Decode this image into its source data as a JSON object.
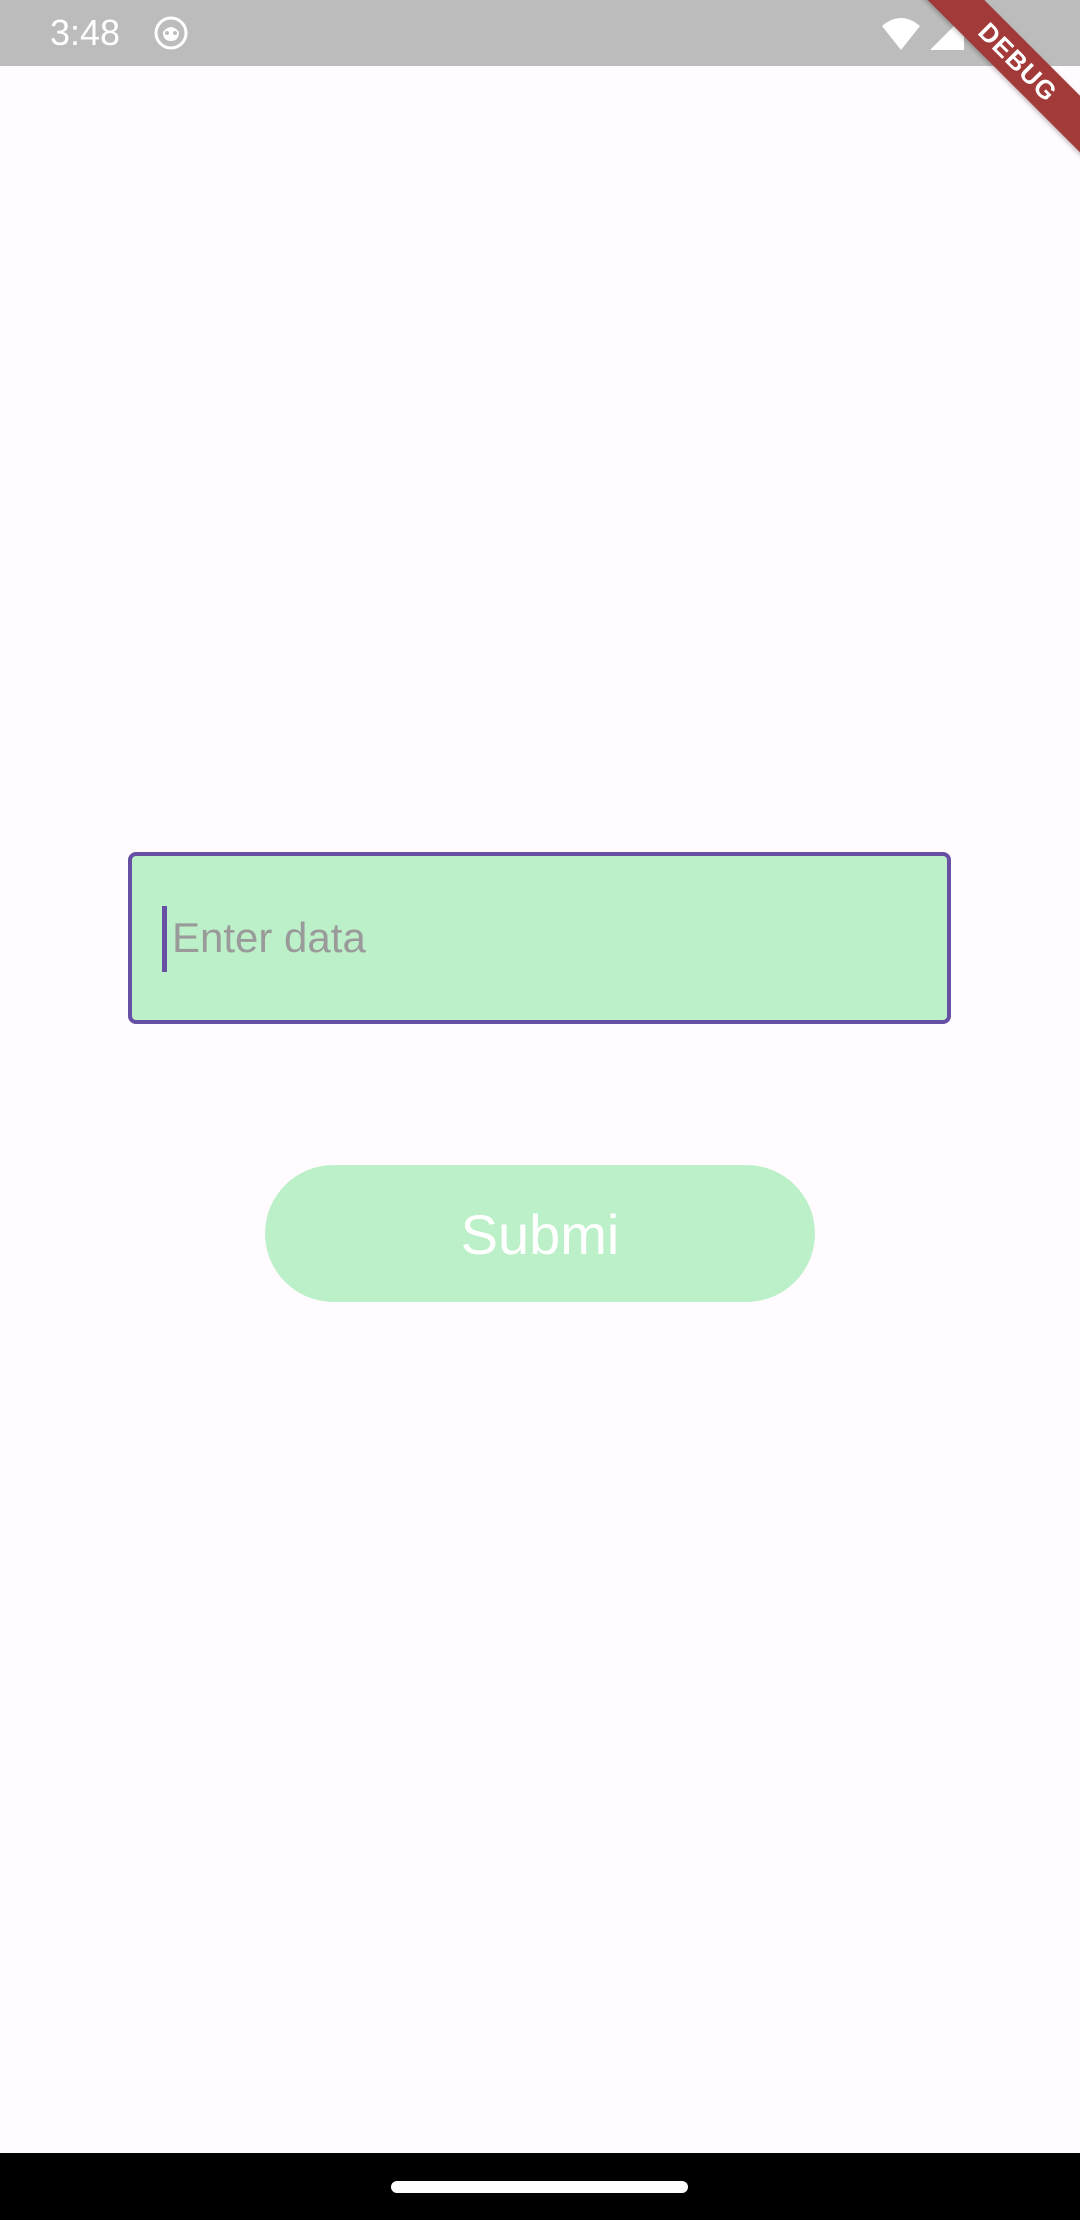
{
  "status_bar": {
    "time": "3:48",
    "icons": [
      "app-notification-icon",
      "wifi-icon",
      "signal-icon",
      "battery-icon"
    ]
  },
  "debug_banner": {
    "label": "DEBUG"
  },
  "form": {
    "input": {
      "value": "",
      "placeholder": "Enter data"
    },
    "submit_label": "Submi"
  },
  "colors": {
    "background": "#fffbfe",
    "status_bar": "#bdbcbc",
    "field_fill": "#bcf0c8",
    "field_border": "#6750a4",
    "button_fill": "#bcf0c8",
    "debug_ribbon": "#a33a3a"
  }
}
